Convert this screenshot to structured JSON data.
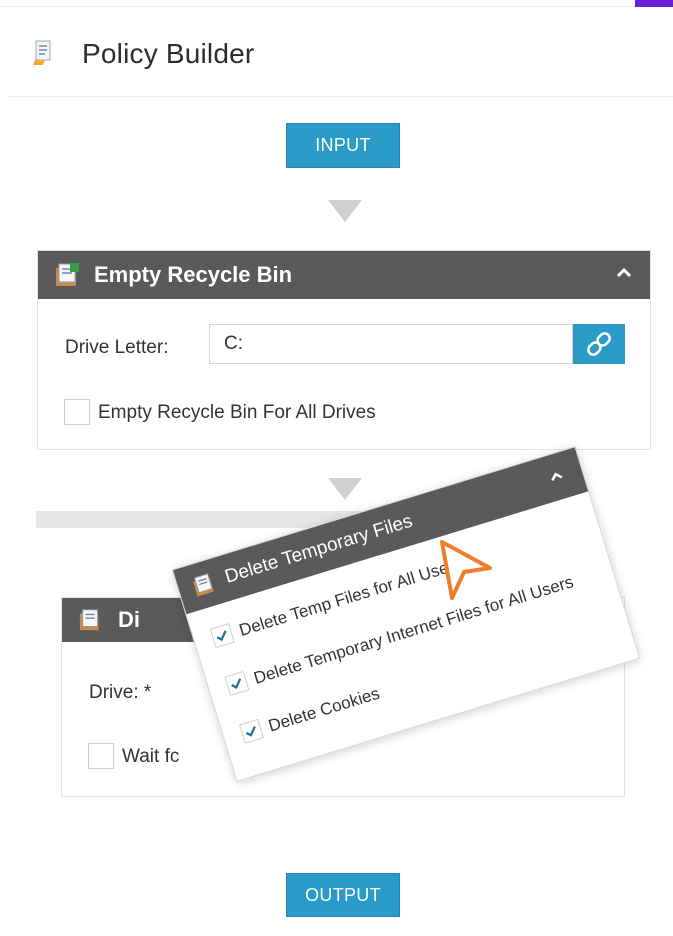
{
  "app": {
    "title": "Policy Builder"
  },
  "flow": {
    "input_label": "INPUT",
    "output_label": "OUTPUT"
  },
  "recycle_panel": {
    "title": "Empty Recycle Bin",
    "drive_label": "Drive Letter:",
    "drive_value": "C:",
    "all_drives_label": "Empty Recycle Bin For All Drives",
    "all_drives_checked": false
  },
  "drive_panel": {
    "title_visible": "Di",
    "drive_label": "Drive: *",
    "wait_label_visible": "Wait fc",
    "wait_checked": false
  },
  "temp_panel": {
    "title": "Delete Temporary Files",
    "options": [
      {
        "label": "Delete Temp Files for All Users",
        "checked": true
      },
      {
        "label": "Delete Temporary Internet Files for All Users",
        "checked": true
      },
      {
        "label": "Delete Cookies",
        "checked": true
      }
    ]
  },
  "colors": {
    "accent": "#2a9bc6",
    "panel_header": "#5a5a5a",
    "cursor": "#f07c2c",
    "corner": "#6a1fd6"
  }
}
